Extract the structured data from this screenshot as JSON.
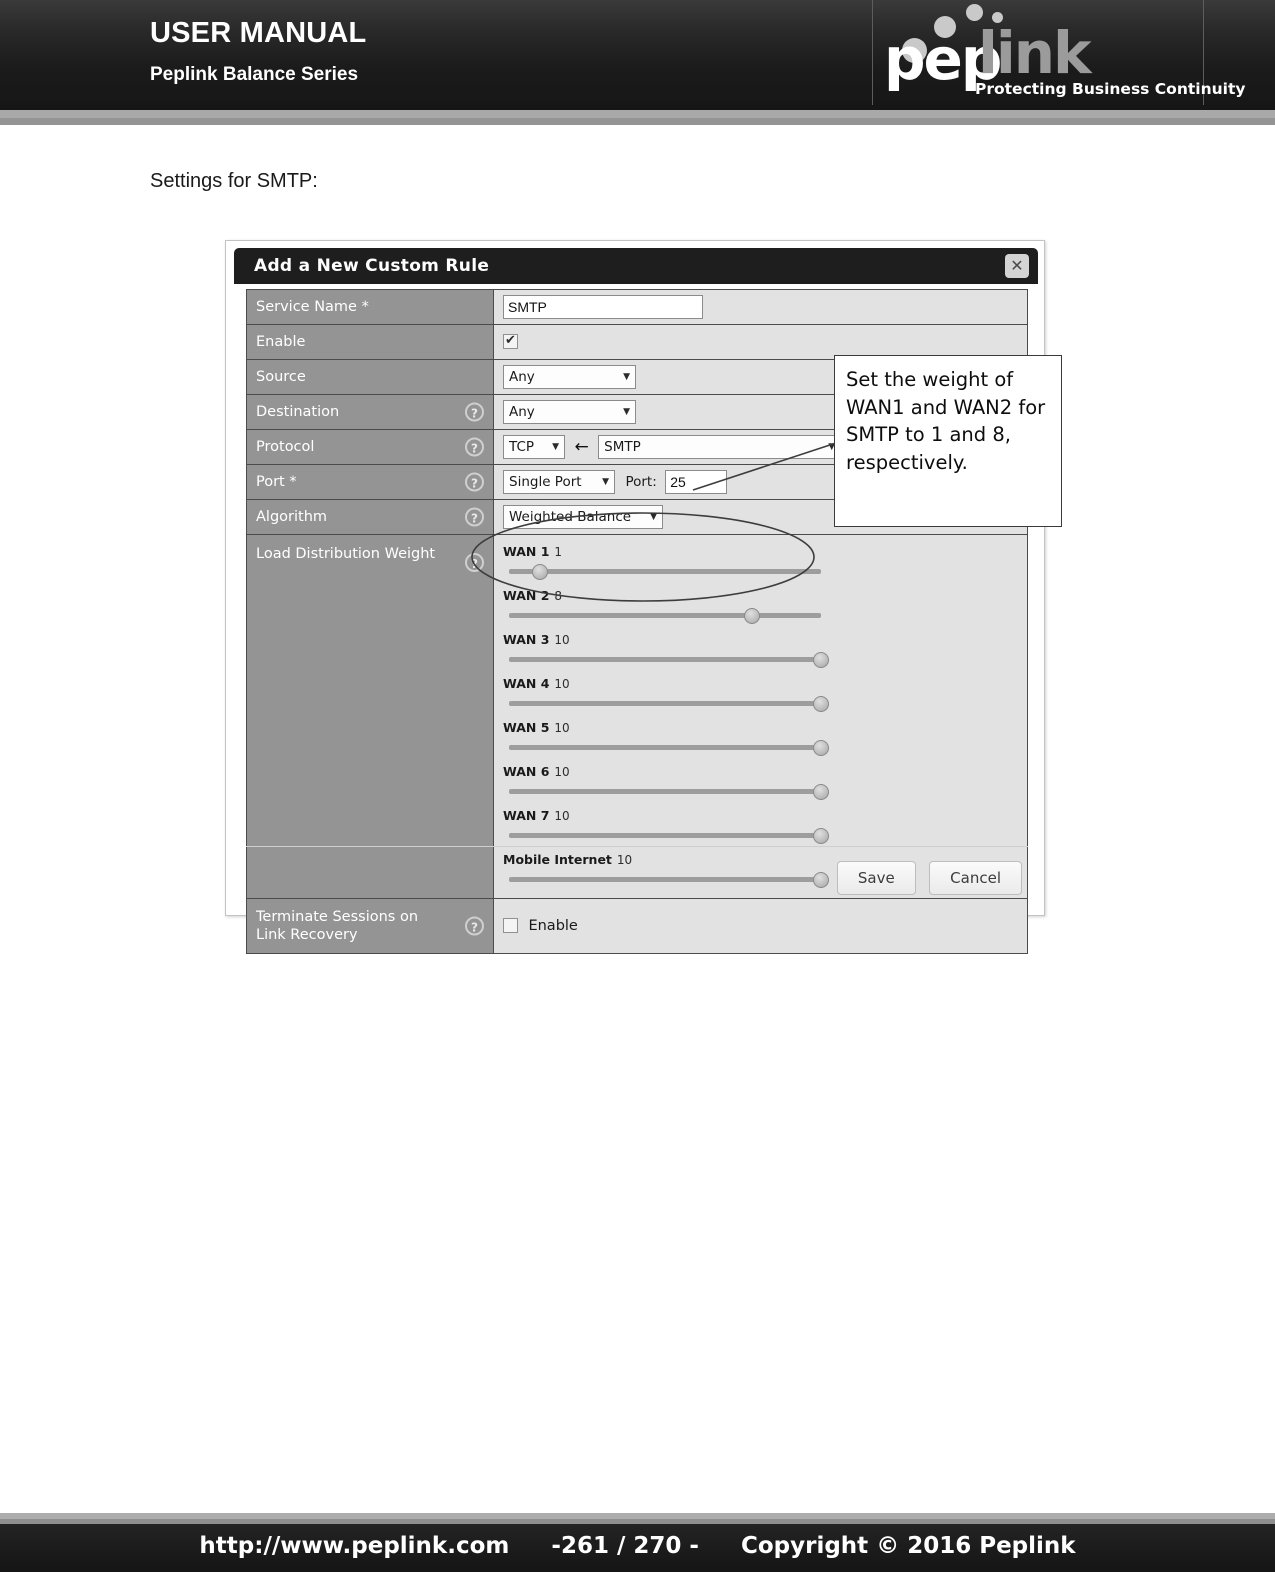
{
  "header": {
    "title": "USER MANUAL",
    "subtitle": "Peplink Balance Series",
    "logo": {
      "word_a": "pep",
      "word_b": "link",
      "tagline": "Protecting Business Continuity"
    }
  },
  "body": {
    "section_label": "Settings for SMTP:"
  },
  "dialog": {
    "title": "Add a New Custom Rule",
    "close_icon": "close-icon",
    "help_icon": "?",
    "rows": {
      "service_name": {
        "label": "Service Name *",
        "value": "SMTP"
      },
      "enable": {
        "label": "Enable",
        "checked": true
      },
      "source": {
        "label": "Source",
        "value": "Any"
      },
      "destination": {
        "label": "Destination",
        "value": "Any",
        "has_help": true
      },
      "protocol": {
        "label": "Protocol",
        "proto_value": "TCP",
        "arrow": "←",
        "service_value": "SMTP",
        "has_help": true
      },
      "port": {
        "label": "Port *",
        "mode_value": "Single Port",
        "port_label": "Port:",
        "port_value": "25",
        "has_help": true
      },
      "algorithm": {
        "label": "Algorithm",
        "value": "Weighted Balance",
        "has_help": true
      },
      "load_distribution_weight": {
        "label": "Load Distribution Weight",
        "has_help": true,
        "wans": [
          {
            "name": "WAN 1",
            "value": "1",
            "percent": 10
          },
          {
            "name": "WAN 2",
            "value": "8",
            "percent": 78
          },
          {
            "name": "WAN 3",
            "value": "10",
            "percent": 100
          },
          {
            "name": "WAN 4",
            "value": "10",
            "percent": 100
          },
          {
            "name": "WAN 5",
            "value": "10",
            "percent": 100
          },
          {
            "name": "WAN 6",
            "value": "10",
            "percent": 100
          },
          {
            "name": "WAN 7",
            "value": "10",
            "percent": 100
          },
          {
            "name": "Mobile Internet",
            "value": "10",
            "percent": 100
          }
        ]
      },
      "terminate_sessions": {
        "label_line1": "Terminate Sessions on",
        "label_line2": "Link Recovery",
        "checkbox_label": "Enable",
        "checked": false,
        "has_help": true
      }
    },
    "save_label": "Save",
    "cancel_label": "Cancel"
  },
  "annotation": {
    "text": "Set the weight of WAN1 and WAN2 for SMTP to 1 and 8, respectively."
  },
  "footer": {
    "url": "http://www.peplink.com",
    "page": "-261 / 270 -",
    "copyright": "Copyright © 2016 Peplink"
  }
}
